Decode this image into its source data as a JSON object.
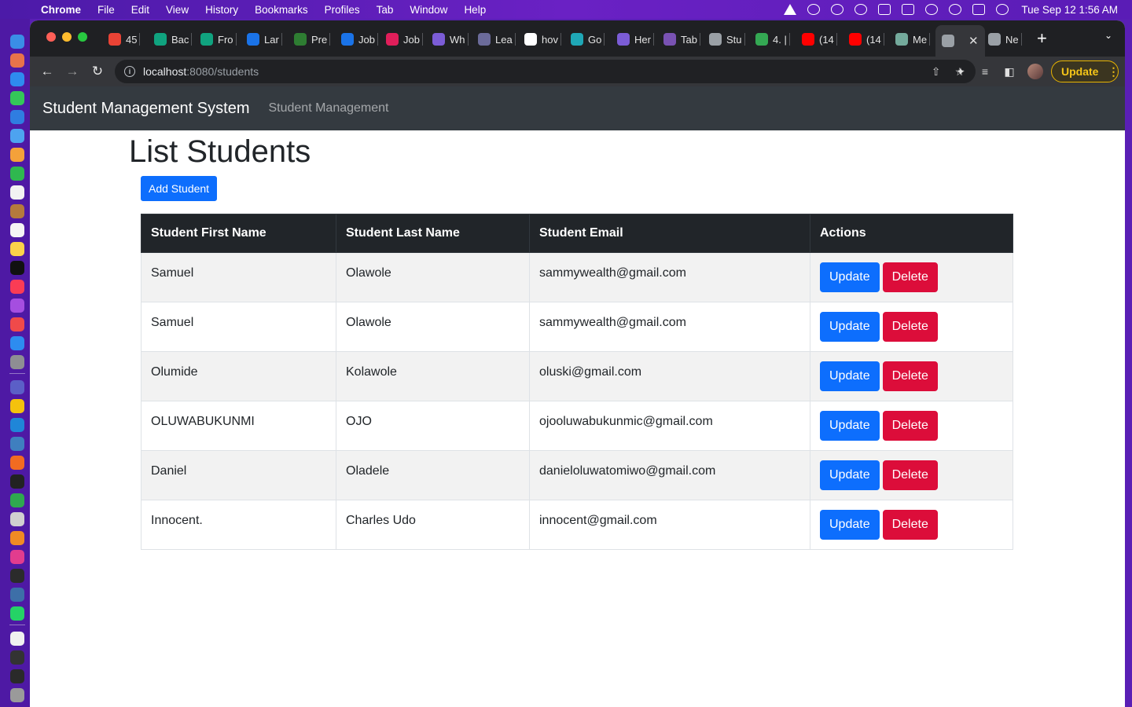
{
  "menubar": {
    "app_name": "Chrome",
    "items": [
      "File",
      "Edit",
      "View",
      "History",
      "Bookmarks",
      "Profiles",
      "Tab",
      "Window",
      "Help"
    ],
    "clock": "Tue Sep 12  1:56 AM"
  },
  "tabs": [
    {
      "label": "45",
      "icon": "gmail-icon",
      "color": "#ea4335"
    },
    {
      "label": "Bac",
      "icon": "chatgpt-icon",
      "color": "#10a37f"
    },
    {
      "label": "Fro",
      "icon": "chatgpt-icon",
      "color": "#10a37f"
    },
    {
      "label": "Lar",
      "icon": "search-icon",
      "color": "#1a73e8"
    },
    {
      "label": "Pre",
      "icon": "grid-icon",
      "color": "#2e7d32"
    },
    {
      "label": "Job",
      "icon": "search-icon",
      "color": "#1a73e8"
    },
    {
      "label": "Job",
      "icon": "slack-icon",
      "color": "#e01e5a"
    },
    {
      "label": "Wh",
      "icon": "hashnode-icon",
      "color": "#7b5cd6"
    },
    {
      "label": "Lea",
      "icon": "code-icon",
      "color": "#6b6b9a"
    },
    {
      "label": "hov",
      "icon": "google-icon",
      "color": "#ffffff"
    },
    {
      "label": "Go",
      "icon": "spiral-icon",
      "color": "#1fa7b6"
    },
    {
      "label": "Her",
      "icon": "hashnode-icon",
      "color": "#7b5cd6"
    },
    {
      "label": "Tab",
      "icon": "bootstrap-icon",
      "color": "#7952b3"
    },
    {
      "label": "Stu",
      "icon": "globe-icon",
      "color": "#9aa0a6"
    },
    {
      "label": "4. |",
      "icon": "drive-icon",
      "color": "#34a853"
    },
    {
      "label": "(14",
      "icon": "youtube-icon",
      "color": "#ff0000"
    },
    {
      "label": "(14",
      "icon": "youtube-icon",
      "color": "#ff0000"
    },
    {
      "label": "Me",
      "icon": "chatgpt-icon",
      "color": "#74aa9c"
    },
    {
      "label": "",
      "icon": "globe-icon",
      "color": "#9aa0a6",
      "active": true
    },
    {
      "label": "Ne",
      "icon": "chrome-icon",
      "color": "#9aa0a6"
    }
  ],
  "address_bar": {
    "host": "localhost",
    "path": ":8080/students"
  },
  "toolbar": {
    "update_label": "Update"
  },
  "navbar": {
    "brand": "Student Management System",
    "link": "Student Management"
  },
  "page": {
    "title": "List Students",
    "add_button": "Add Student",
    "columns": [
      "Student First Name",
      "Student Last Name",
      "Student Email",
      "Actions"
    ],
    "rows": [
      {
        "first": "Samuel",
        "last": "Olawole",
        "email": "sammywealth@gmail.com"
      },
      {
        "first": "Samuel",
        "last": "Olawole",
        "email": "sammywealth@gmail.com"
      },
      {
        "first": "Olumide",
        "last": "Kolawole",
        "email": "oluski@gmail.com"
      },
      {
        "first": "OLUWABUKUNMI",
        "last": "OJO",
        "email": "ojooluwabukunmic@gmail.com"
      },
      {
        "first": "Daniel",
        "last": "Oladele",
        "email": "danieloluwatomiwo@gmail.com"
      },
      {
        "first": "Innocent.",
        "last": "Charles Udo",
        "email": "innocent@gmail.com"
      }
    ],
    "update_label": "Update",
    "delete_label": "Delete"
  },
  "colors": {
    "primary": "#0d6efd",
    "danger": "#dc0d3a",
    "navbar": "#343a40",
    "table_head": "#212529"
  }
}
